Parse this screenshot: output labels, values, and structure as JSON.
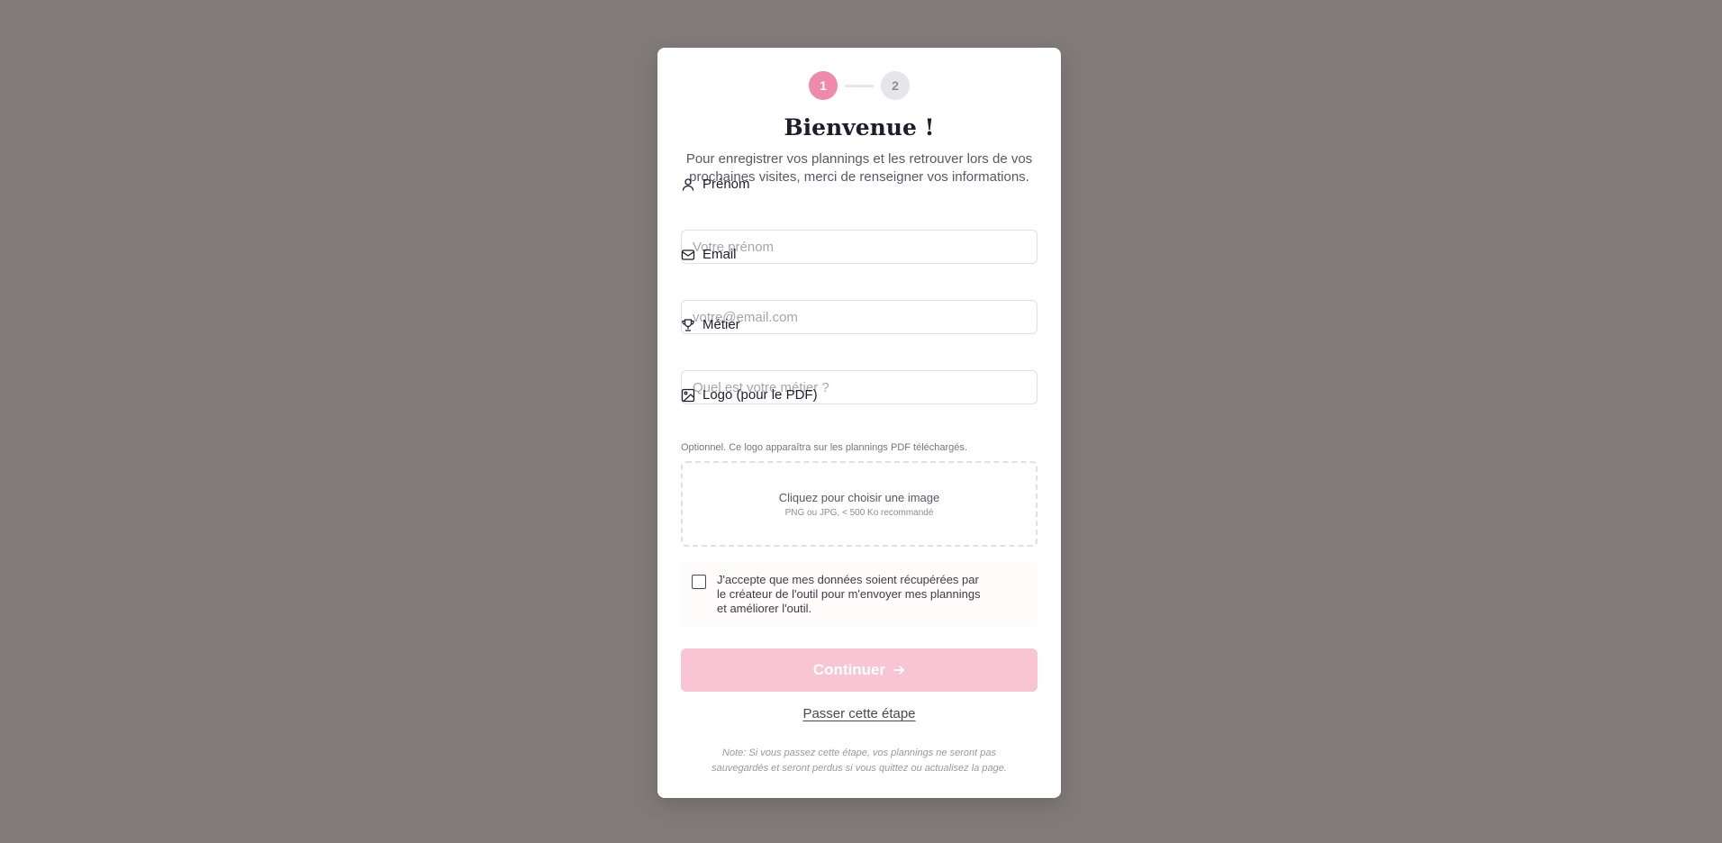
{
  "stepper": {
    "step1": "1",
    "step2": "2",
    "active_color": "#ee8aab"
  },
  "header": {
    "title": "Bienvenue !",
    "subtitle": "Pour enregistrer vos plannings et les retrouver lors de vos prochaines visites, merci de renseigner vos informations."
  },
  "form": {
    "prenom": {
      "label": "Prénom",
      "placeholder": "Votre prénom",
      "value": "",
      "icon": "user-icon"
    },
    "email": {
      "label": "Email",
      "placeholder": "votre@email.com",
      "value": "",
      "icon": "mail-icon"
    },
    "metier": {
      "label": "Métier",
      "placeholder": "Quel est votre métier ?",
      "value": "",
      "icon": "trophy-icon"
    },
    "logo": {
      "label": "Logo (pour le PDF)",
      "hint": "Optionnel. Ce logo apparaîtra sur les plannings PDF téléchargés.",
      "dropzone_main": "Cliquez pour choisir une image",
      "dropzone_sub": "PNG ou JPG, < 500 Ko recommandé",
      "icon": "image-icon"
    },
    "consent": {
      "text": "J'accepte que mes données soient récupérées par le créateur de l'outil pour m'envoyer mes plannings et améliorer l'outil.",
      "checked": false
    }
  },
  "actions": {
    "continue_label": "Continuer",
    "continue_color": "#f7c5d4",
    "skip_label": "Passer cette étape"
  },
  "note": "Note: Si vous passez cette étape, vos plannings ne seront pas sauvegardés et seront perdus si vous quittez ou actualisez la page."
}
